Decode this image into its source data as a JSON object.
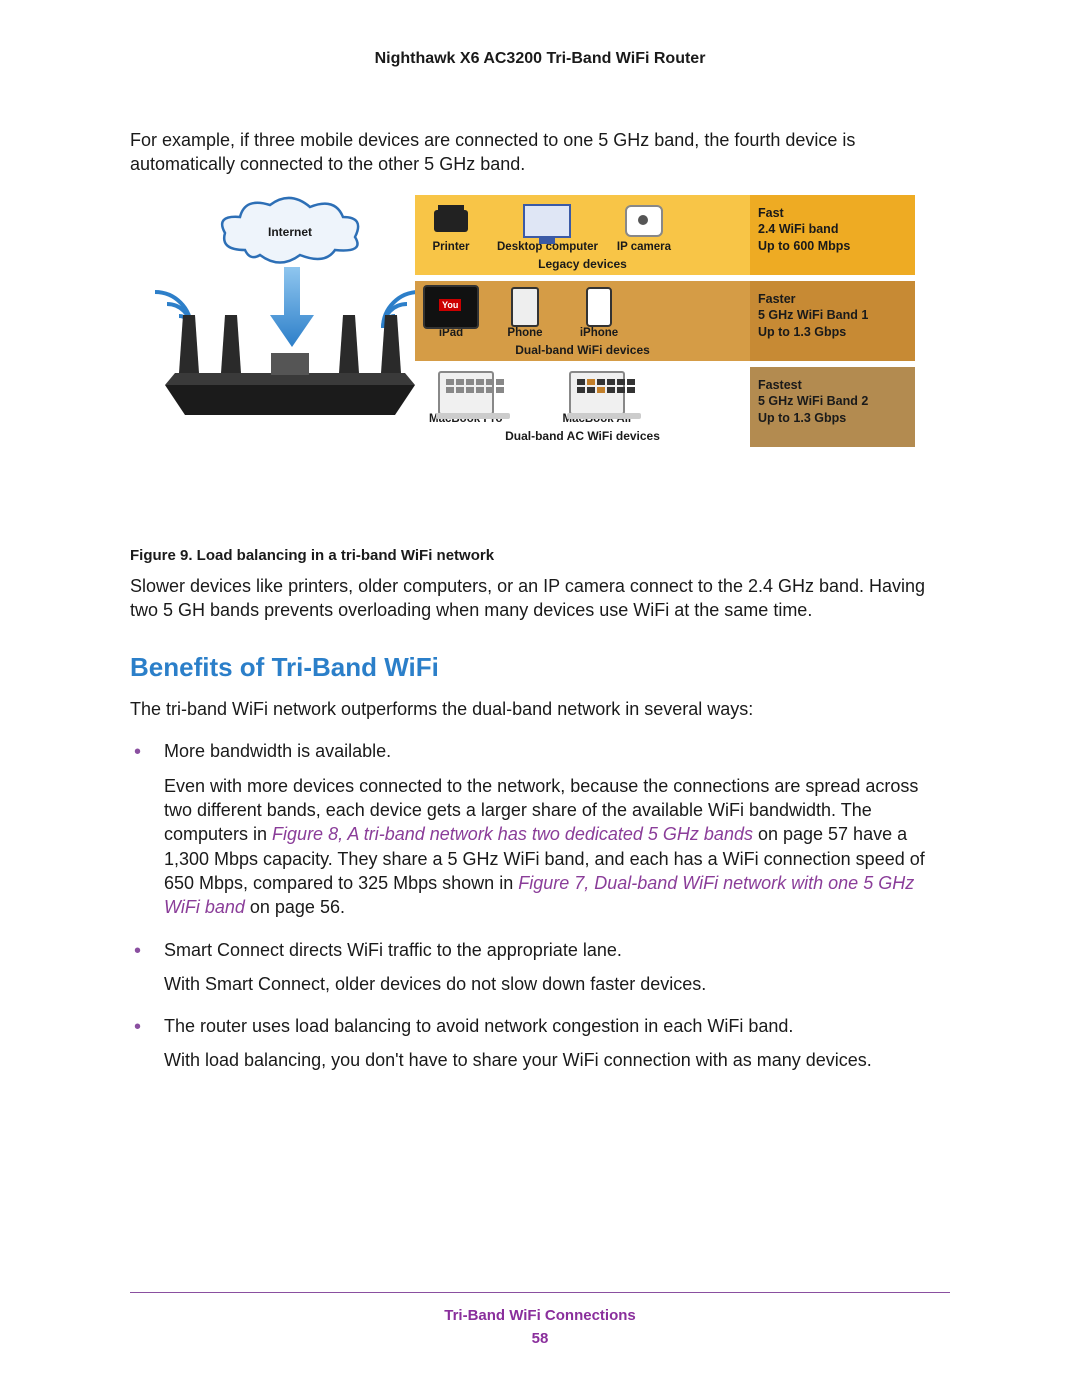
{
  "header": {
    "title": "Nighthawk X6 AC3200 Tri-Band WiFi Router"
  },
  "intro_p": "For example, if three mobile devices are connected to one 5 GHz band, the fourth device is automatically connected to the other 5 GHz band.",
  "figure": {
    "internet_label": "Internet",
    "caption": "Figure 9. Load balancing in a tri-band WiFi network",
    "bands": [
      {
        "devices": [
          {
            "name": "printer",
            "label": "Printer"
          },
          {
            "name": "desktop",
            "label": "Desktop computer"
          },
          {
            "name": "ipcamera",
            "label": "IP camera"
          }
        ],
        "group_label": "Legacy devices",
        "speed_title": "Fast",
        "speed_band": "2.4 WiFi band",
        "speed_rate": "Up to 600 Mbps"
      },
      {
        "devices": [
          {
            "name": "ipad",
            "label": "iPad"
          },
          {
            "name": "phone",
            "label": "Phone"
          },
          {
            "name": "iphone",
            "label": "iPhone"
          }
        ],
        "group_label": "Dual-band WiFi devices",
        "speed_title": "Faster",
        "speed_band": "5 GHz WiFi Band 1",
        "speed_rate": "Up to 1.3 Gbps"
      },
      {
        "devices": [
          {
            "name": "macbookpro",
            "label": "MacBook Pro"
          },
          {
            "name": "macbookair",
            "label": "MacBook Air"
          }
        ],
        "group_label": "Dual-band AC WiFi devices",
        "speed_title": "Fastest",
        "speed_band": "5 GHz WiFi Band 2",
        "speed_rate": "Up to 1.3 Gbps"
      }
    ]
  },
  "after_fig_p": "Slower devices like printers, older computers, or an IP camera connect to the 2.4 GHz band. Having two 5 GH bands prevents overloading when many devices use WiFi at the same time.",
  "section_h": "Benefits of Tri-Band WiFi",
  "section_intro": "The tri-band WiFi network outperforms the dual-band network in several ways:",
  "bullets": [
    {
      "lead": "More bandwidth is available.",
      "body_pre": "Even with more devices connected to the network, because the connections are spread across two different bands, each device gets a larger share of the available WiFi bandwidth. The computers in ",
      "xref1": "Figure 8, A tri-band network has two dedicated 5 GHz bands",
      "body_mid": " on page 57 have a 1,300 Mbps capacity. They share a 5 GHz WiFi band, and each has a WiFi connection speed of 650 Mbps, compared to 325 Mbps shown in ",
      "xref2": "Figure 7, Dual-band WiFi network with one 5 GHz WiFi band",
      "body_post": " on page 56."
    },
    {
      "lead": "Smart Connect directs WiFi traffic to the appropriate lane.",
      "body": "With Smart Connect, older devices do not slow down faster devices."
    },
    {
      "lead": "The router uses load balancing to avoid network congestion in each WiFi band.",
      "body": "With load balancing, you don't have to share your WiFi connection with as many devices."
    }
  ],
  "footer": {
    "section": "Tri-Band WiFi Connections",
    "page": "58"
  }
}
